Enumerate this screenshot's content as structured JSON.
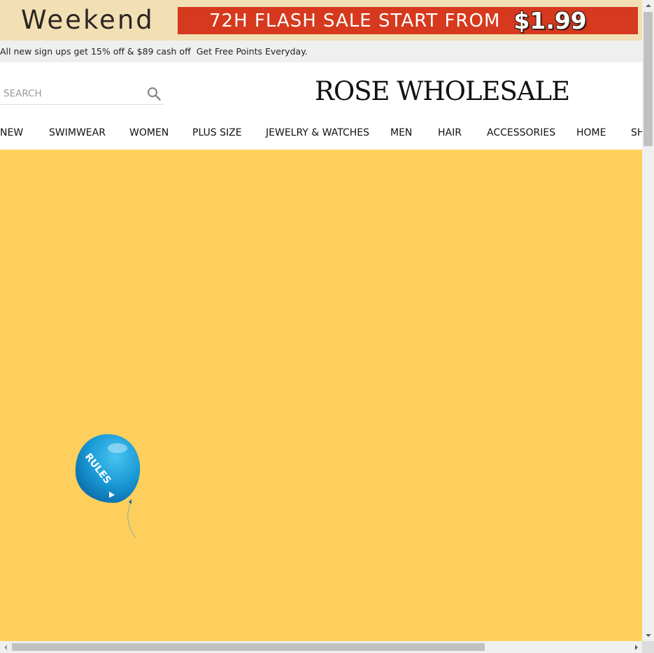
{
  "promo": {
    "weekend_label": "Weekend",
    "flash_text": "72H FLASH SALE START FROM",
    "flash_price": "$1.99"
  },
  "notice": {
    "signup_text": "All new sign ups get 15% off & $89 cash off",
    "points_text": "Get Free Points Everyday."
  },
  "search": {
    "placeholder": "SEARCH"
  },
  "brand": {
    "logo_text": "ROSE WHOLESALE"
  },
  "nav": {
    "items": [
      {
        "label": "NEW"
      },
      {
        "label": "SWIMWEAR"
      },
      {
        "label": "WOMEN"
      },
      {
        "label": "PLUS SIZE"
      },
      {
        "label": "JEWELRY & WATCHES"
      },
      {
        "label": "MEN"
      },
      {
        "label": "HAIR"
      },
      {
        "label": "ACCESSORIES"
      },
      {
        "label": "HOME"
      },
      {
        "label": "SH"
      }
    ]
  },
  "hero": {
    "background_color": "#fecf5d",
    "balloon_label": "RULES"
  },
  "colors": {
    "promo_bg": "#f2dfb4",
    "flash_red": "#d6391d",
    "balloon_blue": "#1a9ad6"
  }
}
